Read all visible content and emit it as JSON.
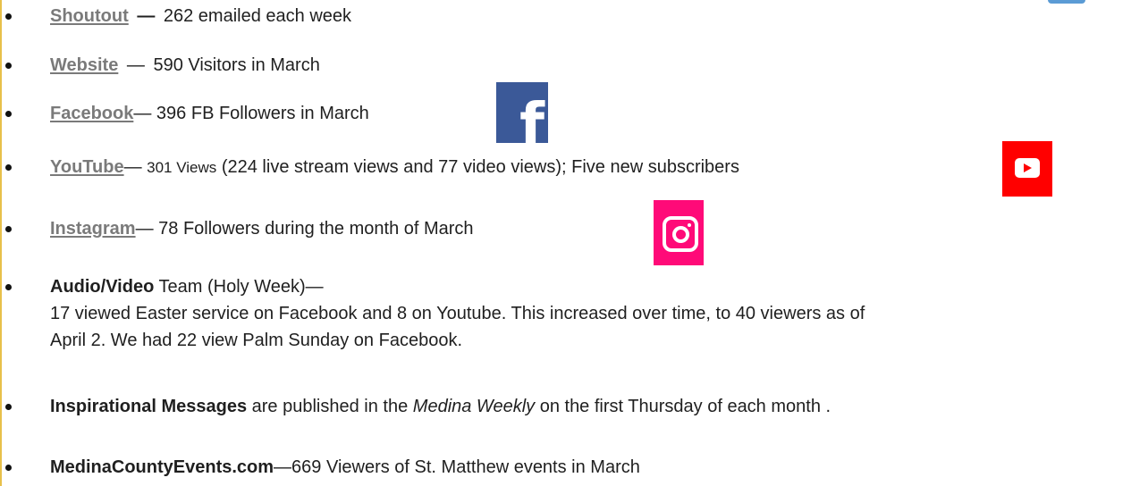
{
  "items": [
    {
      "link": "Shoutout",
      "dash": "—",
      "text": "262 emailed each week"
    },
    {
      "link": "Website",
      "dash": "—",
      "text": "590 Visitors in March"
    },
    {
      "link": "Facebook",
      "dash": "—",
      "text": "396 FB Followers in March"
    },
    {
      "link": "YouTube",
      "dash": "—",
      "text_small": "301 Views",
      "text": "(224 live stream views and 77 video views); Five new subscribers"
    },
    {
      "link": "Instagram",
      "dash": "—",
      "text": "78 Followers during the month of March"
    },
    {
      "bold": "Audio/Video",
      "text": "Team (Holy Week)—",
      "line2": "17 viewed Easter service on Facebook and 8 on Youtube.  This increased over time, to 40 viewers as of",
      "line3": "April 2.  We had 22 view Palm Sunday on Facebook."
    },
    {
      "bold": "Inspirational Messages",
      "text_a": "are published in the",
      "italic": "Medina Weekly",
      "text_b": "on the first Thursday of each month ."
    },
    {
      "bold": "MedinaCountyEvents.com",
      "text": "—669 Viewers of St. Matthew events in March"
    }
  ],
  "icons": {
    "facebook": "facebook-icon",
    "youtube": "youtube-icon",
    "instagram": "instagram-icon",
    "facebook_glyph": "f",
    "colors": {
      "facebook": "#3b5998",
      "youtube": "#ff0000",
      "instagram": "#ff0a78",
      "link": "#7a7a7a"
    }
  }
}
